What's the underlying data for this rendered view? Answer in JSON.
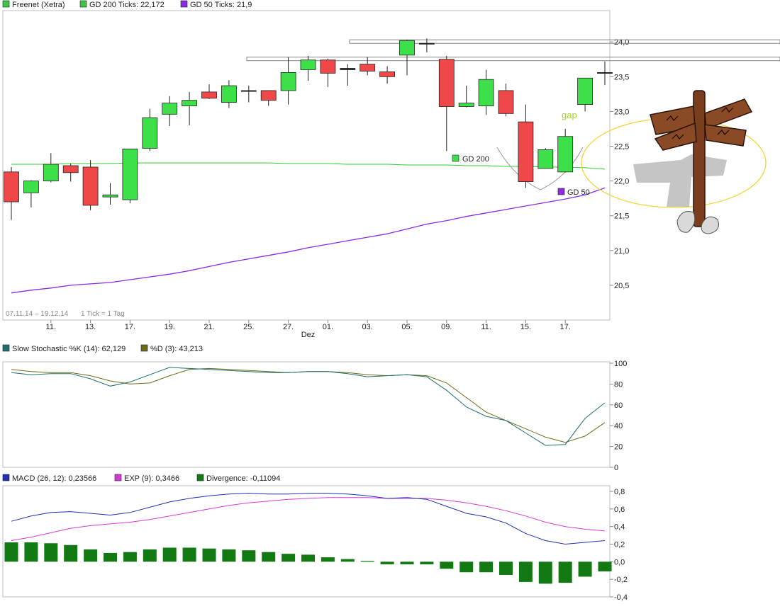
{
  "chart_data": [
    {
      "type": "candlestick",
      "panel": "price",
      "legend": [
        {
          "label": "Freenet (Xetra)",
          "color": "#3ec44a"
        },
        {
          "label": "GD 200 Ticks: 22,172",
          "color": "#3ec44a"
        },
        {
          "label": "GD 50 Ticks: 21,9",
          "color": "#8a2be2"
        }
      ],
      "period_label": "07.11.14 – 19.12.14",
      "tick_label": "1 Tick = 1 Tag",
      "x_tick_labels": [
        "11.",
        "13.",
        "17.",
        "19.",
        "21.",
        "25.",
        "27.",
        "01.",
        "03.",
        "05.",
        "09.",
        "11.",
        "15.",
        "17."
      ],
      "month_label": "Dez",
      "y_tick_labels": [
        "24,0",
        "23,5",
        "23,0",
        "22,5",
        "22,0",
        "21,5",
        "21,0",
        "20,5"
      ],
      "ylim": [
        20.0,
        24.45
      ],
      "candles": [
        {
          "o": 22.13,
          "h": 22.2,
          "l": 21.44,
          "c": 21.7
        },
        {
          "o": 21.83,
          "h": 22.01,
          "l": 21.62,
          "c": 22.0
        },
        {
          "o": 22.0,
          "h": 22.4,
          "l": 21.98,
          "c": 22.24
        },
        {
          "o": 22.22,
          "h": 22.25,
          "l": 21.99,
          "c": 22.12
        },
        {
          "o": 22.2,
          "h": 22.3,
          "l": 21.58,
          "c": 21.65
        },
        {
          "o": 21.77,
          "h": 21.97,
          "l": 21.66,
          "c": 21.8
        },
        {
          "o": 21.73,
          "h": 22.46,
          "l": 21.68,
          "c": 22.46
        },
        {
          "o": 22.47,
          "h": 23.04,
          "l": 22.43,
          "c": 22.91
        },
        {
          "o": 22.96,
          "h": 23.22,
          "l": 22.79,
          "c": 23.12
        },
        {
          "o": 23.08,
          "h": 23.28,
          "l": 22.8,
          "c": 23.16
        },
        {
          "o": 23.28,
          "h": 23.39,
          "l": 23.18,
          "c": 23.19
        },
        {
          "o": 23.13,
          "h": 23.45,
          "l": 23.05,
          "c": 23.37
        },
        {
          "o": 23.3,
          "h": 23.37,
          "l": 23.13,
          "c": 23.3
        },
        {
          "o": 23.3,
          "h": 23.3,
          "l": 23.08,
          "c": 23.16
        },
        {
          "o": 23.3,
          "h": 23.78,
          "l": 23.1,
          "c": 23.56
        },
        {
          "o": 23.6,
          "h": 23.8,
          "l": 23.44,
          "c": 23.74
        },
        {
          "o": 23.74,
          "h": 23.76,
          "l": 23.35,
          "c": 23.55
        },
        {
          "o": 23.6,
          "h": 23.68,
          "l": 23.37,
          "c": 23.62
        },
        {
          "o": 23.68,
          "h": 23.78,
          "l": 23.52,
          "c": 23.58
        },
        {
          "o": 23.57,
          "h": 23.65,
          "l": 23.4,
          "c": 23.5
        },
        {
          "o": 23.81,
          "h": 24.03,
          "l": 23.52,
          "c": 24.02
        },
        {
          "o": 23.98,
          "h": 24.05,
          "l": 23.85,
          "c": 23.98
        },
        {
          "o": 23.75,
          "h": 23.8,
          "l": 22.43,
          "c": 23.07
        },
        {
          "o": 23.07,
          "h": 23.37,
          "l": 23.06,
          "c": 23.12
        },
        {
          "o": 23.08,
          "h": 23.6,
          "l": 22.95,
          "c": 23.46
        },
        {
          "o": 23.3,
          "h": 23.4,
          "l": 22.93,
          "c": 22.97
        },
        {
          "o": 22.85,
          "h": 23.1,
          "l": 21.9,
          "c": 21.99
        },
        {
          "o": 22.18,
          "h": 22.47,
          "l": 22.18,
          "c": 22.45
        },
        {
          "o": 22.13,
          "h": 22.75,
          "l": 22.12,
          "c": 22.64
        },
        {
          "o": 23.1,
          "h": 23.48,
          "l": 23.0,
          "c": 23.48
        },
        {
          "o": 23.56,
          "h": 23.72,
          "l": 23.38,
          "c": 23.56
        }
      ],
      "gd200": [
        22.24,
        22.24,
        22.24,
        22.25,
        22.25,
        22.25,
        22.26,
        22.26,
        22.26,
        22.26,
        22.26,
        22.26,
        22.26,
        22.26,
        22.25,
        22.25,
        22.25,
        22.24,
        22.24,
        22.24,
        22.23,
        22.23,
        22.23,
        22.22,
        22.22,
        22.21,
        22.21,
        22.2,
        22.2,
        22.19,
        22.17
      ],
      "gd50": [
        20.39,
        20.43,
        20.46,
        20.5,
        20.52,
        20.54,
        20.58,
        20.62,
        20.66,
        20.71,
        20.77,
        20.83,
        20.88,
        20.93,
        20.98,
        21.04,
        21.09,
        21.14,
        21.19,
        21.24,
        21.31,
        21.38,
        21.43,
        21.49,
        21.54,
        21.59,
        21.64,
        21.69,
        21.74,
        21.8,
        21.9
      ],
      "resistance": [
        24.0,
        23.75
      ],
      "annotations": {
        "gap": "gap",
        "gd200": "GD 200",
        "gd50": "GD 50"
      }
    },
    {
      "type": "line",
      "panel": "stochastic",
      "legend": [
        {
          "label": "Slow Stochastic %K (14): 62,129",
          "color": "#1f6f6f"
        },
        {
          "label": "%D (3): 43,213",
          "color": "#6b6b1a"
        }
      ],
      "y_tick_labels": [
        "100",
        "80",
        "60",
        "40",
        "20",
        "0"
      ],
      "ylim": [
        0,
        100
      ],
      "series": [
        {
          "values": [
            91,
            89,
            90,
            90,
            85,
            78,
            82,
            89,
            96,
            95,
            94,
            93,
            92,
            91,
            91,
            92,
            92,
            90,
            87,
            88,
            89,
            87,
            74,
            58,
            49,
            45,
            33,
            21,
            22,
            47,
            62
          ]
        },
        {
          "values": [
            94,
            92,
            91,
            91,
            88,
            83,
            80,
            81,
            88,
            94,
            95,
            94,
            93,
            92,
            91,
            92,
            92,
            91,
            89,
            88,
            89,
            88,
            81,
            67,
            53,
            45,
            37,
            29,
            24,
            30,
            43
          ]
        }
      ]
    },
    {
      "type": "line+bar",
      "panel": "macd",
      "legend": [
        {
          "label": "MACD (26, 12): 0,23566",
          "color": "#1f2fb0"
        },
        {
          "label": "EXP (9): 0,3466",
          "color": "#d63ad6"
        },
        {
          "label": "Divergence: -0,11094",
          "color": "#137a13"
        }
      ],
      "y_tick_labels": [
        "0,8",
        "0,6",
        "0,4",
        "0,2",
        "0,0",
        "-0,2",
        "-0,4"
      ],
      "ylim": [
        -0.4,
        0.8
      ],
      "macd": [
        0.46,
        0.52,
        0.56,
        0.57,
        0.55,
        0.53,
        0.56,
        0.62,
        0.68,
        0.72,
        0.75,
        0.77,
        0.78,
        0.77,
        0.77,
        0.78,
        0.78,
        0.77,
        0.75,
        0.72,
        0.73,
        0.71,
        0.63,
        0.55,
        0.51,
        0.44,
        0.32,
        0.24,
        0.2,
        0.22,
        0.24
      ],
      "exp": [
        0.24,
        0.28,
        0.33,
        0.38,
        0.41,
        0.43,
        0.45,
        0.48,
        0.52,
        0.56,
        0.6,
        0.64,
        0.67,
        0.69,
        0.71,
        0.72,
        0.73,
        0.73,
        0.73,
        0.72,
        0.72,
        0.72,
        0.7,
        0.67,
        0.63,
        0.58,
        0.52,
        0.45,
        0.4,
        0.37,
        0.35
      ],
      "divergence": [
        0.22,
        0.22,
        0.21,
        0.19,
        0.14,
        0.1,
        0.11,
        0.14,
        0.16,
        0.16,
        0.15,
        0.14,
        0.13,
        0.11,
        0.09,
        0.08,
        0.05,
        0.03,
        0.01,
        -0.03,
        -0.03,
        -0.03,
        -0.08,
        -0.12,
        -0.12,
        -0.15,
        -0.23,
        -0.25,
        -0.24,
        -0.17,
        -0.11
      ]
    }
  ]
}
